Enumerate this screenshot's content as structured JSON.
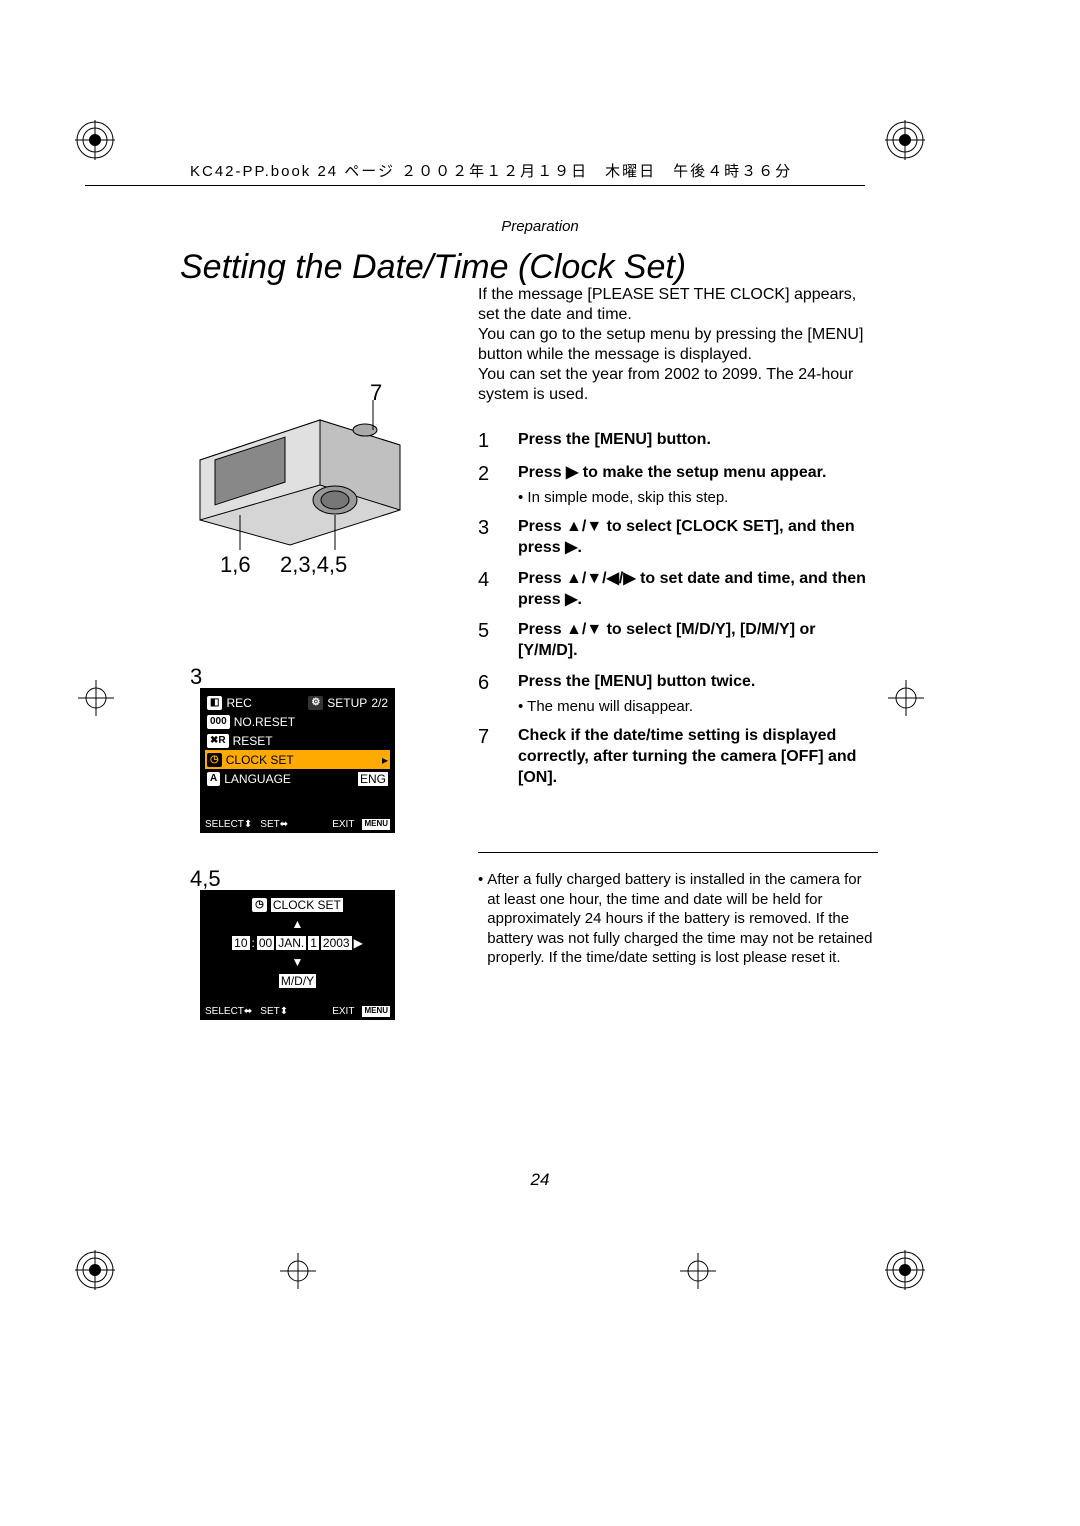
{
  "header": "KC42-PP.book  24 ページ  ２００２年１２月１９日　木曜日　午後４時３６分",
  "section": "Preparation",
  "title": "Setting the Date/Time (Clock Set)",
  "intro": "If the message [PLEASE SET THE CLOCK] appears, set the date and time.\nYou can go to the setup menu by pressing the [MENU] button while the message is displayed.\nYou can set the year from 2002 to 2099. The 24-hour system is used.",
  "steps": [
    {
      "n": "1",
      "text": "Press the [MENU] button."
    },
    {
      "n": "2",
      "text": "Press ▶ to make the setup menu appear.",
      "sub": "In simple mode, skip this step."
    },
    {
      "n": "3",
      "text": "Press ▲/▼ to select [CLOCK SET], and then press ▶."
    },
    {
      "n": "4",
      "text": "Press ▲/▼/◀/▶ to set date and time, and then press ▶."
    },
    {
      "n": "5",
      "text": "Press ▲/▼ to select [M/D/Y], [D/M/Y] or [Y/M/D]."
    },
    {
      "n": "6",
      "text": "Press the [MENU] button twice.",
      "sub": "The menu will disappear."
    },
    {
      "n": "7",
      "text": "Check if the date/time setting is displayed correctly, after turning the camera [OFF] and [ON]."
    }
  ],
  "note": "After a fully charged battery is installed in the camera for at least one hour, the time and date will be held for approximately 24 hours if the battery is removed. If the battery was not fully charged the time may not be retained properly. If the time/date setting is lost please reset it.",
  "page": "24",
  "callouts": {
    "c7": "7",
    "c16": "1,6",
    "c2345": "2,3,4,5",
    "c3": "3",
    "c45": "4,5"
  },
  "lcd1": {
    "rec": "REC",
    "setup": "SETUP",
    "page": "2/2",
    "row1": "NO.RESET",
    "row2": "RESET",
    "row3": "CLOCK SET",
    "row4": "LANGUAGE",
    "row4val": "ENG",
    "footer_select": "SELECT",
    "footer_set": "SET",
    "footer_exit": "EXIT",
    "footer_menu": "MENU"
  },
  "lcd2": {
    "title": "CLOCK SET",
    "time_h": "10",
    "time_m": "00",
    "month": "JAN.",
    "day": "1",
    "year": "2003",
    "format": "M/D/Y",
    "footer_select": "SELECT",
    "footer_set": "SET",
    "footer_exit": "EXIT",
    "footer_menu": "MENU"
  }
}
